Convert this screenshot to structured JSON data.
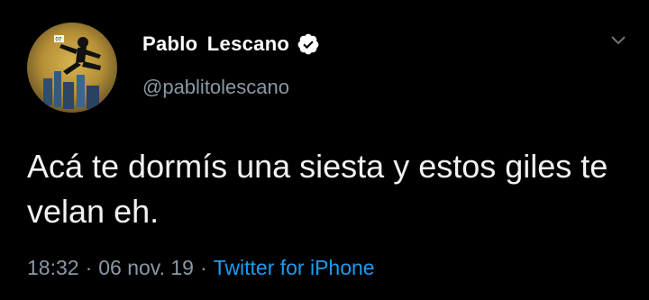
{
  "user": {
    "display_name": "Pablo  Lescano",
    "handle": "@pablitolescano",
    "verified": true,
    "avatar_badge": "07"
  },
  "tweet": {
    "text": "Acá te dormís una siesta y estos giles te velan eh."
  },
  "meta": {
    "time": "18:32",
    "separator": "·",
    "date": "06 nov. 19",
    "source": "Twitter for iPhone"
  },
  "colors": {
    "background": "#000000",
    "text": "#f0f2f3",
    "secondary": "#8b98a5",
    "link": "#1d9bf0"
  },
  "icons": {
    "verified": "verified-badge-icon",
    "more": "chevron-down-icon"
  }
}
